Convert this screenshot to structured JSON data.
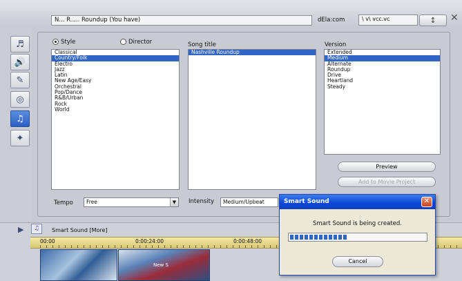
{
  "top": {
    "name_value": "N... R..... Roundup (You have)",
    "duration_label": "dEla:com",
    "duration_value": "\\ v\\  vcc.vc",
    "spinner_glyph": "↕",
    "close_glyph": "✕"
  },
  "sidebar": {
    "icons": [
      "video-icon",
      "audio-icon",
      "title-icon",
      "disc-icon",
      "music-icon",
      "effects-icon"
    ]
  },
  "panel": {
    "radio_style": "Style",
    "radio_director": "Director",
    "styles_header": "Style",
    "songs_header": "Song title",
    "versions_header": "Version",
    "styles": [
      "Classical",
      "Country/Folk",
      "Electro",
      "Jazz",
      "Latin",
      "New Age/Easy",
      "Orchestral",
      "Pop/Dance",
      "R&B/Urban",
      "Rock",
      "World"
    ],
    "styles_selected": 1,
    "songs": [
      "Nashville Roundup"
    ],
    "songs_selected": 0,
    "versions": [
      "Extended",
      "Medium",
      "Alternate",
      "Roundup",
      "Drive",
      "Heartland",
      "Steady"
    ],
    "versions_selected": 1,
    "preview_button": "Preview",
    "add_button": "Add to Movie Project",
    "tempo_label": "Tempo",
    "tempo_value": "Free",
    "intensity_label": "Intensity",
    "intensity_value": "Medium/Upbeat"
  },
  "timeline": {
    "track_label": "Smart Sound [More]",
    "ruler_marks": [
      "00:00",
      "0:00:24:00",
      "0:00:48:00"
    ],
    "clip_text": "New S"
  },
  "dialog": {
    "title": "Smart Sound",
    "close_glyph": "✕",
    "message": "Smart Sound is being created.",
    "progress_percent": 43,
    "cancel_label": "Cancel"
  }
}
